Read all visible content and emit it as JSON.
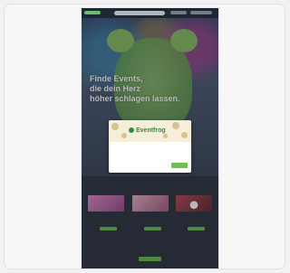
{
  "site": {
    "search_placeholder": "",
    "nav_primary": "",
    "nav_secondary": ""
  },
  "hero": {
    "title_line1": "Finde Events,",
    "title_line2": "die dein Herz",
    "title_line3": "höher schlagen lassen.",
    "subtitle": ""
  },
  "modal": {
    "brand": "Eventfrog",
    "body_text": "",
    "link_text": "",
    "primary_button": "",
    "secondary_button": ""
  },
  "listing": {
    "section_title": "",
    "events": [
      {
        "name": "",
        "button": "",
        "thumb_color": "#d06fb0"
      },
      {
        "name": "",
        "button": "",
        "thumb_color": "#c56a8f"
      },
      {
        "name": "",
        "button": "",
        "thumb_color": "#b84a50"
      }
    ],
    "more_text": "",
    "more_button": "",
    "footer": ""
  },
  "colors": {
    "brand_green": "#2f8f3a",
    "button_green": "#68b84d",
    "hero_bg": "#3a4a6a"
  }
}
